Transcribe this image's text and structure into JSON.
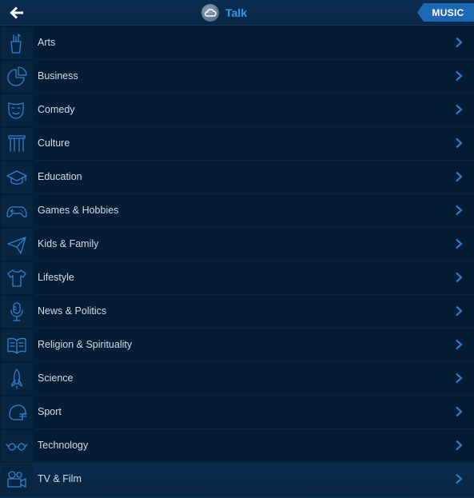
{
  "header": {
    "title": "Talk",
    "back_icon": "arrow-left-icon",
    "logo_icon": "cloud-logo-icon",
    "music_label": "MUSIC"
  },
  "colors": {
    "background": "#051c35",
    "accent": "#2f9ae8",
    "button": "#1d68b5",
    "icon_stroke": "#2d82d3"
  },
  "categories": [
    {
      "label": "Arts",
      "icon": "paint-brushes-icon"
    },
    {
      "label": "Business",
      "icon": "pie-chart-icon"
    },
    {
      "label": "Comedy",
      "icon": "comedy-mask-icon"
    },
    {
      "label": "Culture",
      "icon": "column-icon"
    },
    {
      "label": "Education",
      "icon": "graduation-cap-icon"
    },
    {
      "label": "Games & Hobbies",
      "icon": "gamepad-icon"
    },
    {
      "label": "Kids & Family",
      "icon": "paper-plane-icon"
    },
    {
      "label": "Lifestyle",
      "icon": "tshirt-icon"
    },
    {
      "label": "News & Politics",
      "icon": "microphone-icon"
    },
    {
      "label": "Religion & Spirituality",
      "icon": "open-book-icon"
    },
    {
      "label": "Science",
      "icon": "rocket-icon"
    },
    {
      "label": "Sport",
      "icon": "football-helmet-icon"
    },
    {
      "label": "Technology",
      "icon": "glasses-icon"
    },
    {
      "label": "TV & Film",
      "icon": "video-camera-icon",
      "selected": true
    }
  ]
}
